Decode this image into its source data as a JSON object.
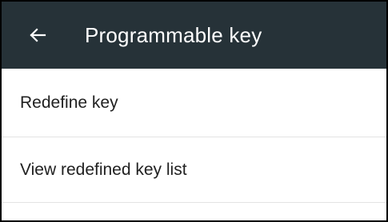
{
  "appbar": {
    "title": "Programmable key",
    "back_icon": "arrow-back-icon",
    "background_color": "#263238",
    "text_color": "#ffffff"
  },
  "menu": {
    "items": [
      {
        "label": "Redefine key"
      },
      {
        "label": "View redefined key list"
      }
    ]
  }
}
